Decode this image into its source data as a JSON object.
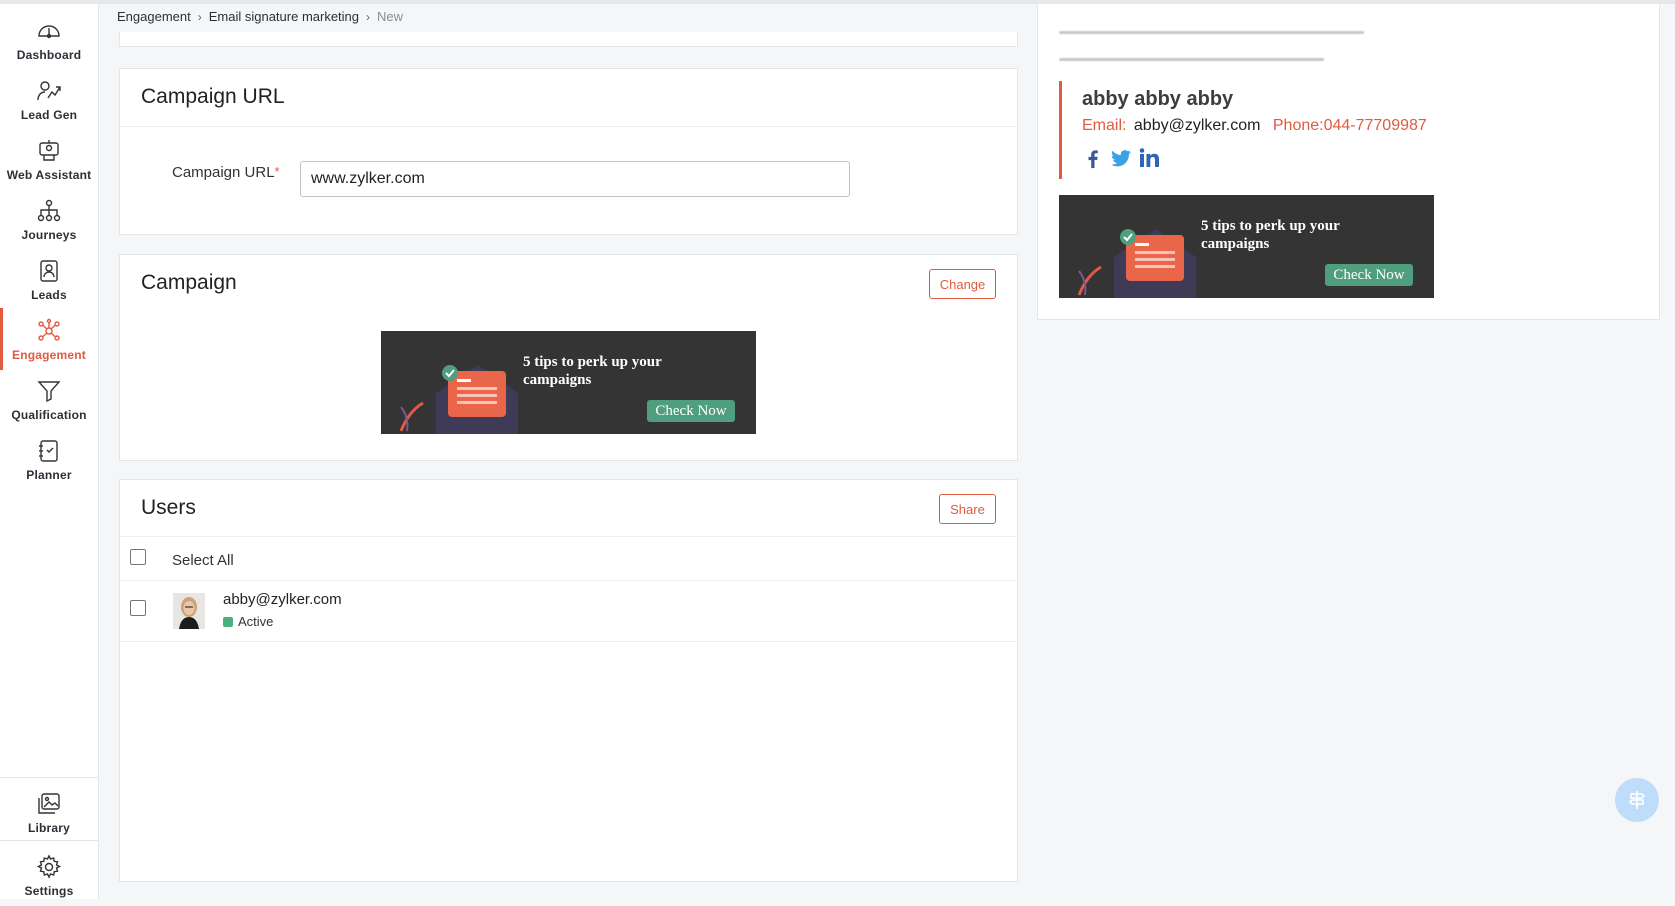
{
  "sidebar": {
    "items": [
      {
        "label": "Dashboard",
        "icon": "dashboard-icon"
      },
      {
        "label": "Lead Gen",
        "icon": "lead-gen-icon"
      },
      {
        "label": "Web Assistant",
        "icon": "web-assistant-icon"
      },
      {
        "label": "Journeys",
        "icon": "journeys-icon"
      },
      {
        "label": "Leads",
        "icon": "leads-icon"
      },
      {
        "label": "Engagement",
        "icon": "engagement-icon",
        "active": true
      },
      {
        "label": "Qualification",
        "icon": "qualification-icon"
      },
      {
        "label": "Planner",
        "icon": "planner-icon"
      }
    ],
    "bottom": [
      {
        "label": "Library",
        "icon": "library-icon"
      },
      {
        "label": "Settings",
        "icon": "gear-icon"
      }
    ]
  },
  "breadcrumb": {
    "items": [
      "Engagement",
      "Email signature marketing",
      "New"
    ]
  },
  "campaign_url": {
    "title": "Campaign URL",
    "field_label": "Campaign URL",
    "required_mark": "*",
    "value": "www.zylker.com"
  },
  "campaign": {
    "title": "Campaign",
    "change_label": "Change",
    "banner": {
      "headline_1": "5 tips to perk up your",
      "headline_2": "campaigns",
      "cta": "Check Now"
    }
  },
  "users": {
    "title": "Users",
    "share_label": "Share",
    "select_all_label": "Select All",
    "rows": [
      {
        "email": "abby@zylker.com",
        "status": "Active"
      }
    ]
  },
  "preview": {
    "name": "abby abby abby",
    "email_label": "Email:",
    "email_value": "abby@zylker.com",
    "phone": "Phone:044-77709987",
    "socials": [
      "facebook-icon",
      "twitter-icon",
      "linkedin-icon"
    ],
    "banner": {
      "headline_1": "5 tips to perk up your",
      "headline_2": "campaigns",
      "cta": "Check Now"
    }
  },
  "colors": {
    "accent": "#e25a3f",
    "success": "#4caf7d",
    "banner_bg": "#343434",
    "cta_bg": "#4f9e7f",
    "social_blue": "#3b5998"
  }
}
